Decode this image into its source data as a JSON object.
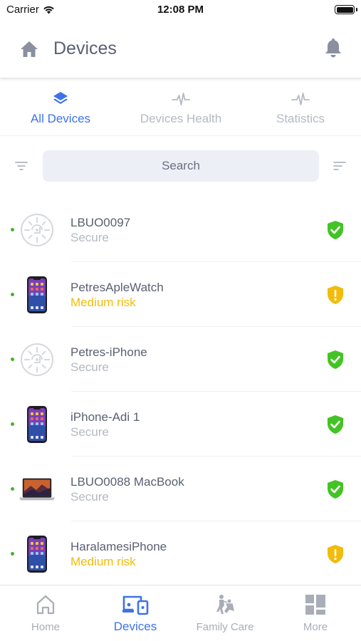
{
  "status_bar": {
    "carrier": "Carrier",
    "time": "12:08 PM",
    "battery_level": 1.0
  },
  "header": {
    "title": "Devices",
    "home_icon": "home-icon",
    "bell_icon": "bell-icon"
  },
  "tabs": [
    {
      "label": "All Devices",
      "icon": "layers-icon",
      "active": true
    },
    {
      "label": "Devices Health",
      "icon": "pulse-icon",
      "active": false
    },
    {
      "label": "Statistics",
      "icon": "pulse-icon",
      "active": false
    }
  ],
  "search": {
    "placeholder": "Search",
    "filter_icon": "filter-icon",
    "sort_icon": "sort-icon"
  },
  "devices": [
    {
      "name": "LBUO0097",
      "status": "Secure",
      "risk": false,
      "type": "generic",
      "online": true
    },
    {
      "name": "PetresApleWatch",
      "status": "Medium risk",
      "risk": true,
      "type": "phone",
      "online": true
    },
    {
      "name": "Petres-iPhone",
      "status": "Secure",
      "risk": false,
      "type": "generic",
      "online": true
    },
    {
      "name": "iPhone-Adi 1",
      "status": "Secure",
      "risk": false,
      "type": "phone",
      "online": true
    },
    {
      "name": "LBUO0088 MacBook",
      "status": "Secure",
      "risk": false,
      "type": "laptop",
      "online": true
    },
    {
      "name": "HaralamesiPhone",
      "status": "Medium risk",
      "risk": true,
      "type": "phone",
      "online": true
    }
  ],
  "bottom_nav": [
    {
      "label": "Home",
      "icon": "home-outline-icon",
      "active": false
    },
    {
      "label": "Devices",
      "icon": "devices-icon",
      "active": true
    },
    {
      "label": "Family Care",
      "icon": "family-care-icon",
      "active": false
    },
    {
      "label": "More",
      "icon": "grid-icon",
      "active": false
    }
  ],
  "colors": {
    "accent": "#3d73e6",
    "secure": "#44c325",
    "risk": "#f2bc0c",
    "online": "#46b32c"
  }
}
